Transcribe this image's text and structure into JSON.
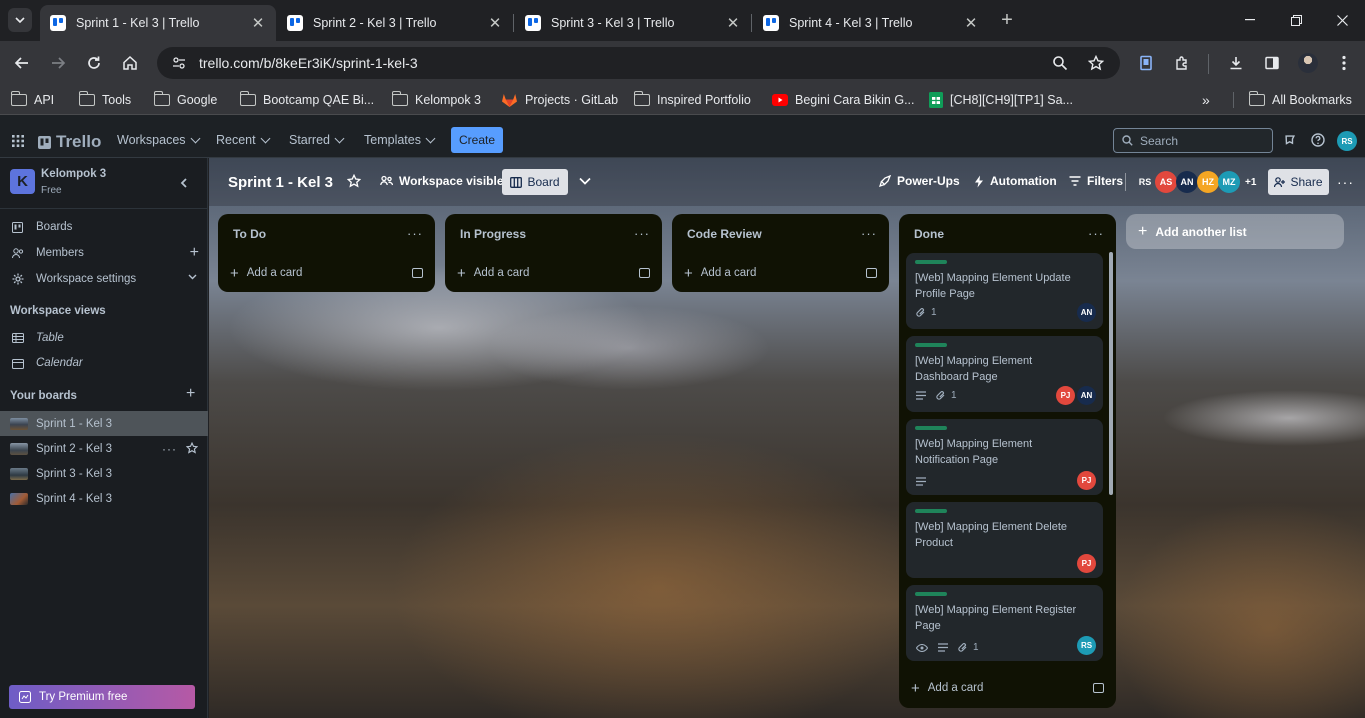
{
  "browser": {
    "tabs": [
      {
        "title": "Sprint 1 - Kel 3 | Trello",
        "active": true
      },
      {
        "title": "Sprint 2 - Kel 3 | Trello",
        "active": false
      },
      {
        "title": "Sprint 3 - Kel 3 | Trello",
        "active": false
      },
      {
        "title": "Sprint 4 - Kel 3 | Trello",
        "active": false
      }
    ],
    "url": "trello.com/b/8keEr3iK/sprint-1-kel-3",
    "bookmarks": [
      {
        "label": "API",
        "icon": "folder-icon"
      },
      {
        "label": "Tools",
        "icon": "folder-icon"
      },
      {
        "label": "Google",
        "icon": "folder-icon"
      },
      {
        "label": "Bootcamp QAE Bi...",
        "icon": "folder-icon"
      },
      {
        "label": "Kelompok 3",
        "icon": "folder-icon"
      },
      {
        "label": "Projects · GitLab",
        "icon": "gitlab-icon"
      },
      {
        "label": "Inspired Portfolio",
        "icon": "folder-icon"
      },
      {
        "label": "Begini Cara Bikin G...",
        "icon": "youtube-icon"
      },
      {
        "label": "[CH8][CH9][TP1] Sa...",
        "icon": "sheets-icon"
      }
    ],
    "all_bookmarks": "All Bookmarks"
  },
  "trello_header": {
    "logo": "Trello",
    "nav": [
      "Workspaces",
      "Recent",
      "Starred",
      "Templates"
    ],
    "create": "Create",
    "search_placeholder": "Search",
    "user_initials": "RS"
  },
  "sidebar": {
    "workspace_initial": "K",
    "workspace_name": "Kelompok 3",
    "plan": "Free",
    "items": [
      "Boards",
      "Members",
      "Workspace settings"
    ],
    "views_heading": "Workspace views",
    "views": [
      "Table",
      "Calendar"
    ],
    "boards_heading": "Your boards",
    "boards": [
      "Sprint 1 - Kel 3",
      "Sprint 2 - Kel 3",
      "Sprint 3 - Kel 3",
      "Sprint 4 - Kel 3"
    ],
    "premium": "Try Premium free"
  },
  "board": {
    "title": "Sprint 1 - Kel 3",
    "visibility": "Workspace visible",
    "view": "Board",
    "powerups": "Power-Ups",
    "automation": "Automation",
    "filters": "Filters",
    "members": [
      {
        "initials": "RS",
        "color": "#1d9bb5"
      },
      {
        "initials": "AS",
        "color": "#e2483d"
      },
      {
        "initials": "AN",
        "color": "#172b4d"
      },
      {
        "initials": "HZ",
        "color": "#f5a623"
      },
      {
        "initials": "MZ",
        "color": "#1d9bb5"
      }
    ],
    "more_members": "+1",
    "share": "Share",
    "add_list": "Add another list",
    "lists": [
      {
        "title": "To Do",
        "add_card": "Add a card",
        "cards": []
      },
      {
        "title": "In Progress",
        "add_card": "Add a card",
        "cards": []
      },
      {
        "title": "Code Review",
        "add_card": "Add a card",
        "cards": []
      },
      {
        "title": "Done",
        "add_card": "Add a card",
        "cards": [
          {
            "text": "[Web] Mapping Element Update Profile Page",
            "attachments": "1",
            "member": "AN"
          },
          {
            "text": "[Web] Mapping Element Dashboard Page",
            "attachments": "1",
            "members": [
              "PJ",
              "AN"
            ]
          },
          {
            "text": "[Web] Mapping Element Notification Page",
            "member": "PJ"
          },
          {
            "text": "[Web] Mapping Element Delete Product",
            "member": "PJ"
          },
          {
            "text": "[Web] Mapping Element Register Page",
            "attachments": "1",
            "member": "RS"
          }
        ]
      }
    ]
  }
}
